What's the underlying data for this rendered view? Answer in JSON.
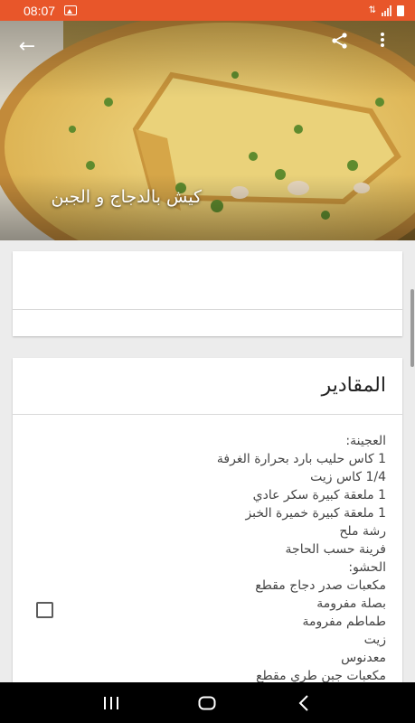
{
  "status_bar": {
    "time": "08:07",
    "icons": [
      "image-icon",
      "signal-icon",
      "battery-icon"
    ]
  },
  "header": {
    "title": "كيش بالدجاج و الجبن",
    "back_icon": "arrow-back-icon",
    "share_icon": "share-icon",
    "more_icon": "more-vert-icon"
  },
  "ingredients_card": {
    "title": "المقادير",
    "items": [
      "العجينة:",
      "1 كاس حليب بارد بحرارة الغرفة",
      "1/4 كاس زيت",
      "1 ملعقة كبيرة سكر عادي",
      "1 ملعقة كبيرة خميرة الخبز",
      "رشة ملح",
      "فرينة حسب الحاجة",
      "الحشو:",
      "مكعبات صدر دجاج مقطع",
      "بصلة مفرومة",
      "طماطم مفرومة",
      "زيت",
      "معدنوس",
      "مكعبات جبن طري مقطع"
    ]
  },
  "nav_bar": {
    "icons": [
      "recents-icon",
      "home-icon",
      "back-icon"
    ]
  },
  "colors": {
    "status_bar": "#e8562a",
    "nav_bar": "#000000",
    "background": "#ececec"
  }
}
